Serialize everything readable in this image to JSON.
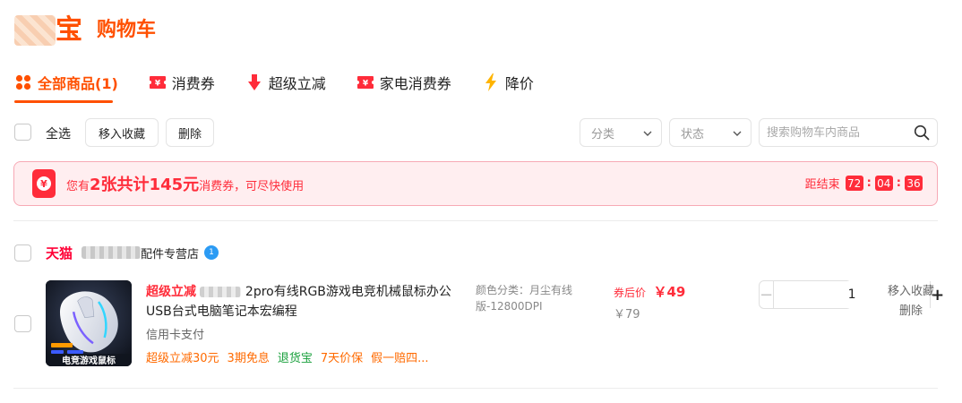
{
  "header": {
    "logo_char": "宝",
    "title": "购物车"
  },
  "tabs": [
    {
      "label": "全部商品(1)",
      "icon": "grid-icon",
      "active": true
    },
    {
      "label": "消费券",
      "icon": "coupon-icon"
    },
    {
      "label": "超级立减",
      "icon": "down-arrow-icon"
    },
    {
      "label": "家电消费券",
      "icon": "coupon-icon"
    },
    {
      "label": "降价",
      "icon": "lightning-icon"
    }
  ],
  "toolbar": {
    "select_all": "全选",
    "move_to_favorites": "移入收藏",
    "delete": "删除",
    "category_select": "分类",
    "status_select": "状态",
    "search_placeholder": "搜索购物车内商品"
  },
  "banner": {
    "prefix": "您有",
    "highlight": "2张共计145元",
    "suffix": "消费券，可尽快使用",
    "countdown_label": "距结束",
    "hours": "72",
    "minutes": "04",
    "seconds": "36",
    "icon_glyph": "¥"
  },
  "shop": {
    "platform": "天猫",
    "name_suffix": "配件专营店",
    "badge": "1"
  },
  "item": {
    "promo": "超级立减",
    "title_rest": "2pro有线RGB游戏电竞机械鼠标办公USB台式电脑笔记本宏编程",
    "payment": "信用卡支付",
    "tags": [
      "超级立减30元",
      "3期免息",
      "退货宝",
      "7天价保",
      "假一赔四..."
    ],
    "spec_label": "颜色分类：月尘有线版-12800DPI",
    "price_label": "券后价",
    "price_now": "￥49",
    "price_orig": "￥79",
    "quantity": "1",
    "action_favorite": "移入收藏",
    "action_delete": "删除",
    "image_text": "电竞游戏鼠标"
  },
  "colors": {
    "brand": "#ff5000",
    "red": "#ff2c3a",
    "tmall": "#ff0036",
    "green": "#19a03c"
  }
}
